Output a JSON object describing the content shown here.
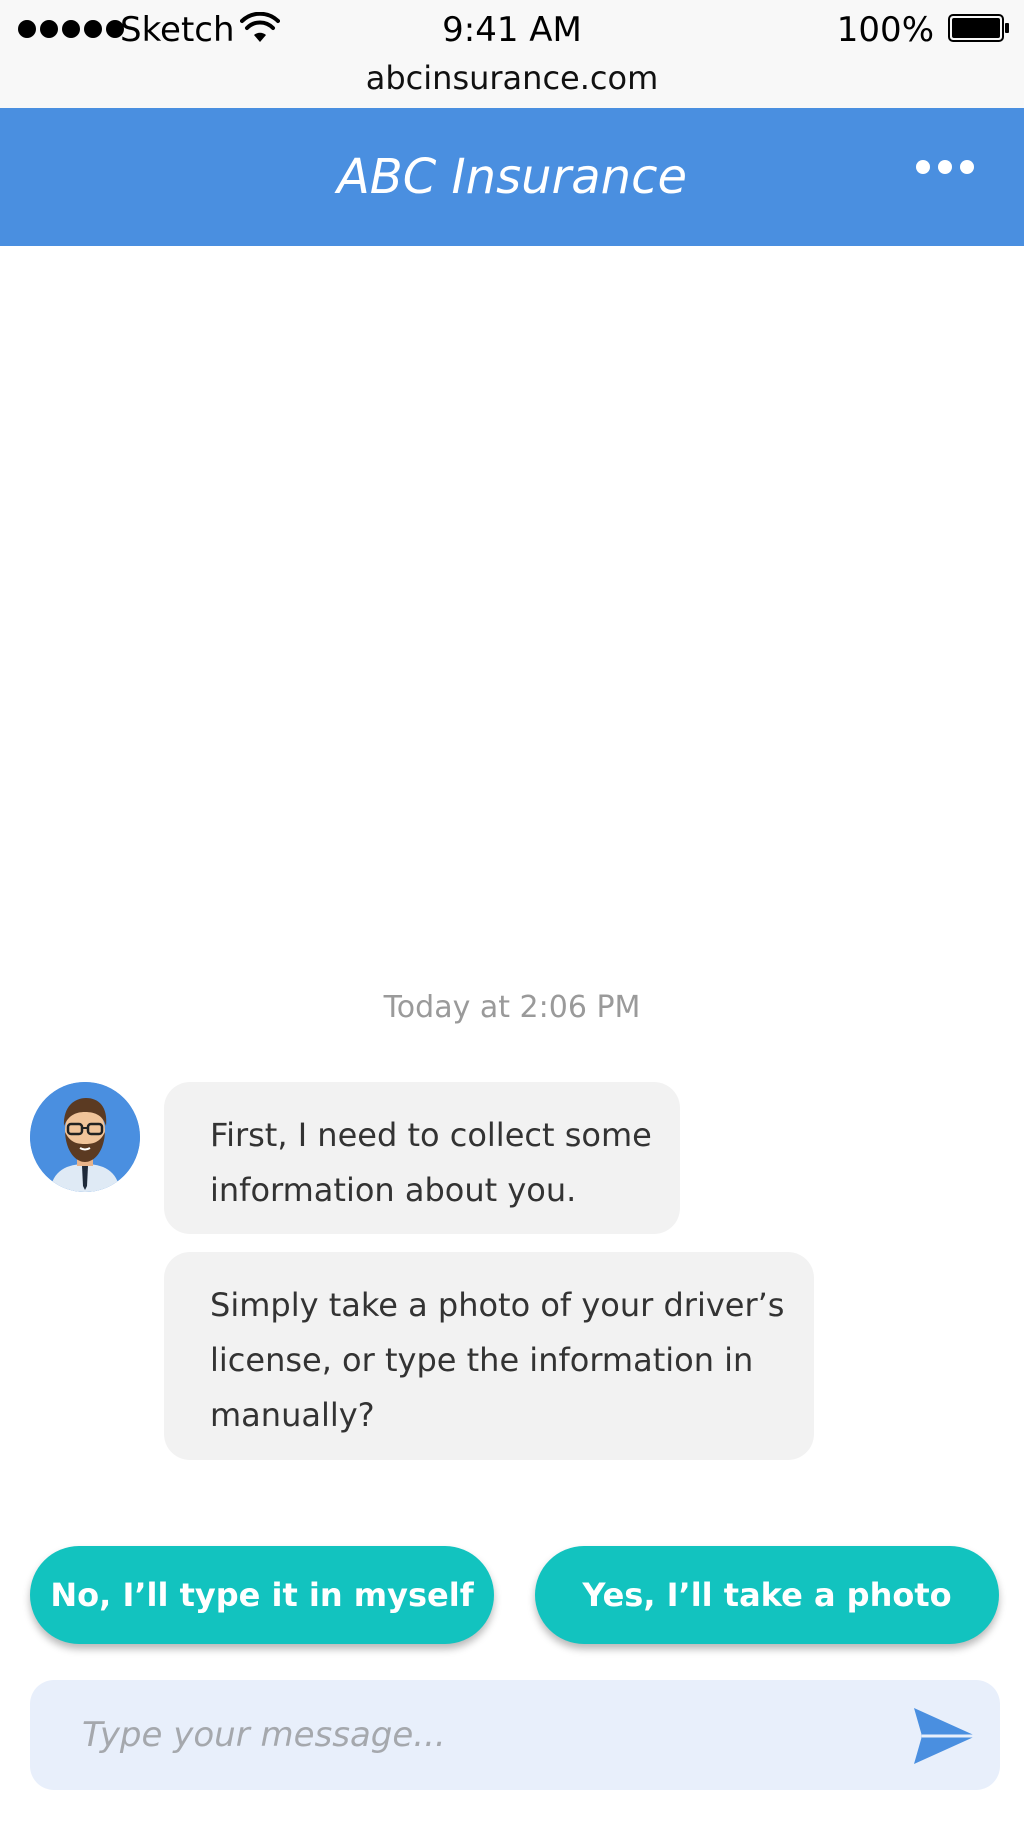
{
  "status_bar": {
    "carrier": "Sketch",
    "time": "9:41 AM",
    "battery_percent": "100%",
    "url": "abcinsurance.com"
  },
  "header": {
    "title": "ABC Insurance",
    "menu_icon": "more-horizontal-icon"
  },
  "chat": {
    "timestamp": "Today at 2:06 PM",
    "messages": [
      {
        "lines": [
          "First, I need to collect some",
          "information about you."
        ]
      },
      {
        "lines": [
          "Simply take a photo of your driver’s",
          "license, or type the information in",
          "manually?"
        ]
      }
    ]
  },
  "quick_replies": {
    "no_label": "No, I’ll type it in myself",
    "yes_label": "Yes, I’ll take a photo"
  },
  "composer": {
    "placeholder": "Type your message...",
    "value": "",
    "send_icon": "send-icon"
  },
  "colors": {
    "header": "#4a8fe0",
    "quick_reply": "#12c3bf",
    "composer_bg": "#e8effb",
    "bubble_bg": "#f2f2f2"
  }
}
